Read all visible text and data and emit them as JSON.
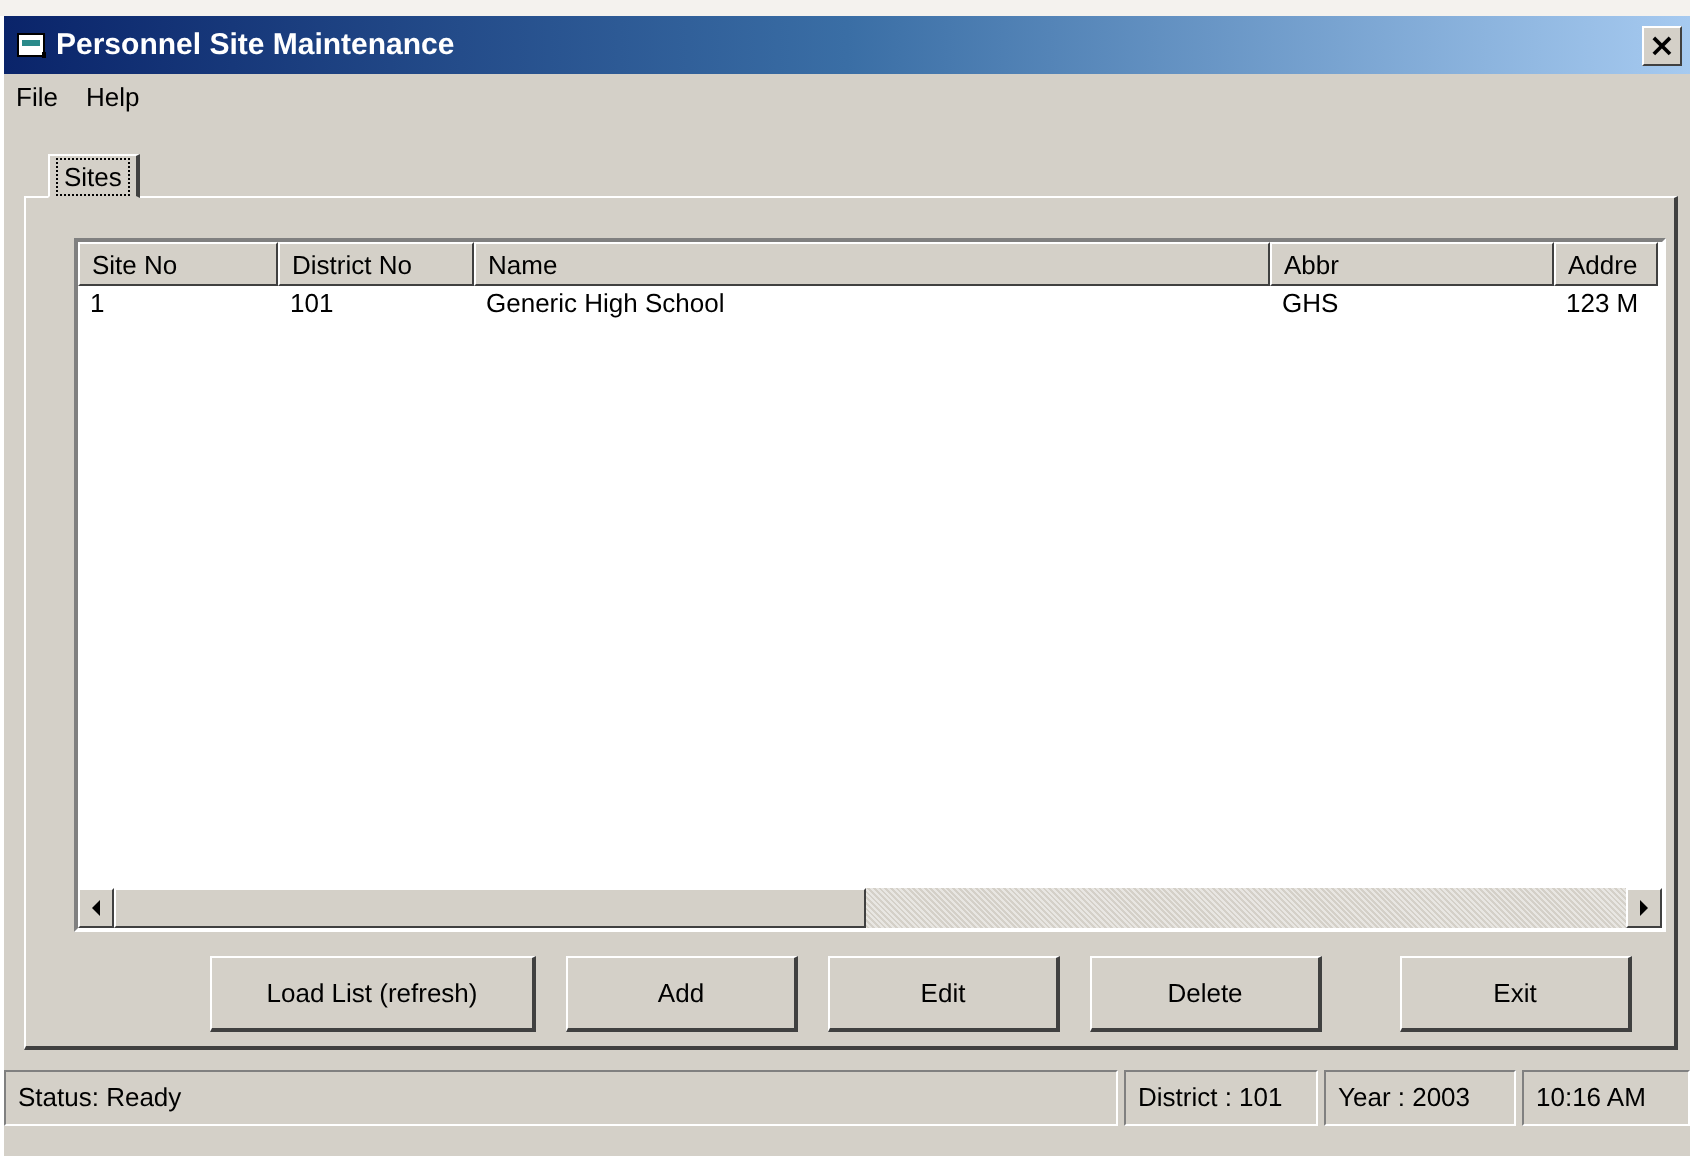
{
  "window": {
    "title": "Personnel Site Maintenance",
    "close": "×"
  },
  "menu": [
    {
      "label": "File"
    },
    {
      "label": "Help"
    }
  ],
  "tabs": [
    {
      "label": "Sites",
      "selected": true
    }
  ],
  "table": {
    "columns": [
      {
        "label": "Site No"
      },
      {
        "label": "District No"
      },
      {
        "label": "Name"
      },
      {
        "label": "Abbr"
      },
      {
        "label": "Addre"
      }
    ],
    "rows": [
      [
        "1",
        "101",
        "Generic High School",
        "GHS",
        "123 M"
      ]
    ]
  },
  "buttons": [
    {
      "label": "Load List (refresh)"
    },
    {
      "label": "Add"
    },
    {
      "label": "Edit"
    },
    {
      "label": "Delete"
    },
    {
      "label": "Exit"
    }
  ],
  "status_bar": [
    "Status: Ready",
    "District : 101",
    "Year : 2003",
    "10:16 AM"
  ]
}
